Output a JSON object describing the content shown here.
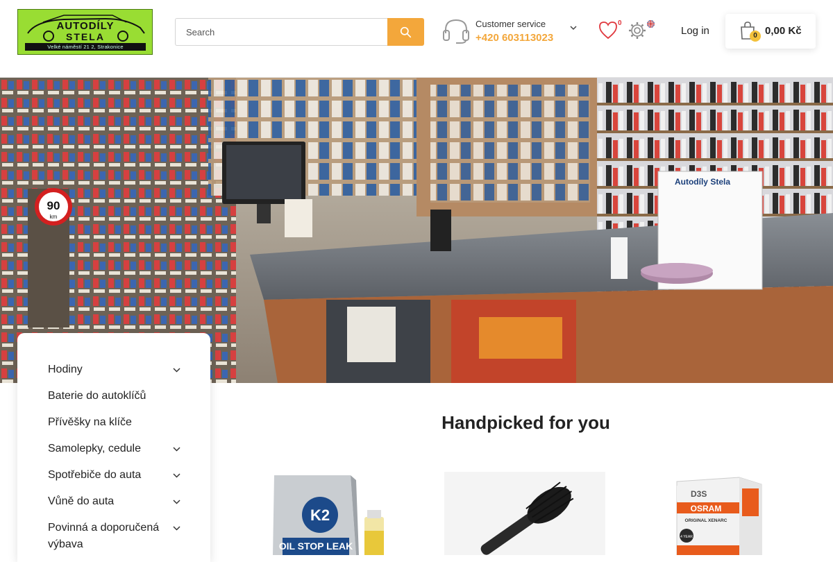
{
  "header": {
    "logo": {
      "brand_line1": "AUTODÍLY",
      "brand_line2": "STELA",
      "address": "Velké náměstí 21 2, Strakonice"
    },
    "search": {
      "placeholder": "Search"
    },
    "customer_service": {
      "label": "Customer service",
      "phone": "+420 603113023"
    },
    "wishlist": {
      "count": "0"
    },
    "login_label": "Log in",
    "cart": {
      "count": "0",
      "total": "0,00 Kč"
    }
  },
  "hero": {
    "sign_title": "Autodíly Stela",
    "speed_sign": "90",
    "speed_unit": "km"
  },
  "sidebar": {
    "categories": [
      {
        "label": "Hodiny",
        "has_children": true
      },
      {
        "label": "Baterie do autoklíčů",
        "has_children": false
      },
      {
        "label": "Přívěšky na klíče",
        "has_children": false
      },
      {
        "label": "Samolepky, cedule",
        "has_children": true
      },
      {
        "label": "Spotřebiče do auta",
        "has_children": true
      },
      {
        "label": "Vůně do auta",
        "has_children": true
      },
      {
        "label": "Povinná a doporučená výbava",
        "has_children": true
      }
    ]
  },
  "main": {
    "heading": "Handpicked for you",
    "products": [
      {
        "brand": "K2",
        "label": "OIL STOP LEAK"
      },
      {
        "label": "brush"
      },
      {
        "brand": "OSRAM",
        "model": "D3S",
        "line": "ORIGINAL XENARC",
        "warranty": "4 YEAR"
      }
    ]
  },
  "colors": {
    "accent": "#f3a73b",
    "logo_bg": "#99dd33",
    "heart": "#e0383e"
  }
}
